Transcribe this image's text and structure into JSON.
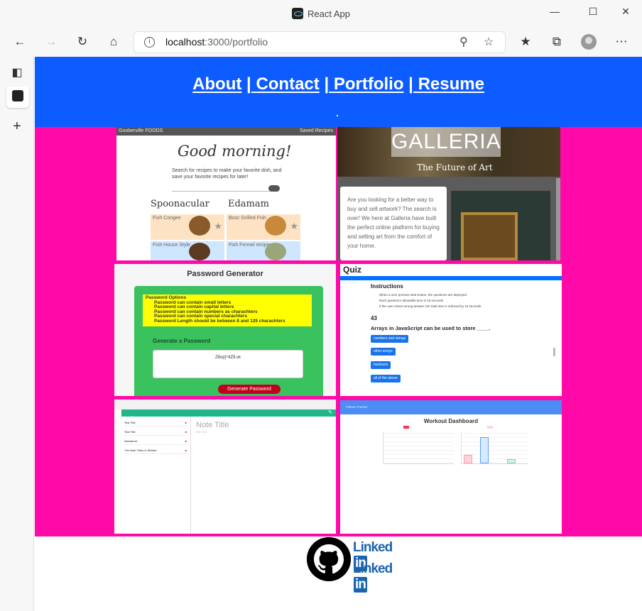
{
  "browser": {
    "window_title": "React App",
    "address_host": "localhost",
    "address_path": ":3000/portfolio"
  },
  "nav": {
    "about": "About",
    "contact": "Contact",
    "portfolio": "Portfolio",
    "resume": "Resume",
    "separator": "|"
  },
  "header_dot": ".",
  "projects": [
    {
      "name": "recipes",
      "bar_title": "Gooberville FOODS",
      "bar_right": "Saved Recipes",
      "heading": "Good morning!",
      "subheading": "Search for recipes to make your favorite dish, and save your favorite recipes for later!",
      "col1": "Spoonacular",
      "col2": "Edamam",
      "cards": [
        "Fish Congee",
        "Bosc Grilled Fish",
        "Fish House Style",
        "Fish Fennel recipes"
      ]
    },
    {
      "name": "galleria",
      "title": "GALLERIA",
      "tagline": "The Future of Art",
      "body": "Are you looking for a better way to buy and sell artwork? The search is over! We here at Galleria have built the perfect online platform for buying and selling art from the comfort of your home."
    },
    {
      "name": "password-generator",
      "title": "Password Generator",
      "options_title": "Password Options",
      "options": [
        "Password can contain small letters",
        "Password can contain capital letters",
        "Password can contain numbers as charachters",
        "Password can contain special charachters",
        "Password Length should be between 8 and 129 charachters"
      ],
      "generate_heading": "Generate a Password",
      "output": "Z8op}*4Z9.vk",
      "button": "Generate Password"
    },
    {
      "name": "quiz",
      "title": "Quiz",
      "bar_label": "View Scores",
      "instructions_title": "Instructions",
      "instructions": [
        "When a user presses start button, the questions are deployed",
        "Each question's allowable time is 15 seconds",
        "If the user enters wrong answer, the total time is reduced by 10 seconds"
      ],
      "timer": "43",
      "question": "Arrays in JavaScript can be used to store ____.",
      "answers": [
        "numbers and strings",
        "other arrays",
        "booleans",
        "all of the above"
      ]
    },
    {
      "name": "note-taker",
      "app_title": "Note Taker",
      "notes": [
        "Test Title",
        "Test Title",
        "Newsbeat",
        "The Note Taker Is Started"
      ],
      "note_title_placeholder": "Note Title",
      "note_text_placeholder": "Note Text"
    },
    {
      "name": "workout-dashboard",
      "bar_label": "Fitness Tracker",
      "title": "Workout Dashboard"
    }
  ],
  "footer": {
    "linkedin_word": "Linked",
    "linkedin_in": "in"
  },
  "colors": {
    "header": "#0d5cff",
    "grid_background": "#ff0aa8",
    "footer": "#ffffff"
  },
  "icons": [
    "back-icon",
    "forward-icon",
    "refresh-icon",
    "home-icon",
    "info-icon",
    "zoom-icon",
    "add-favorite-icon",
    "favorites-icon",
    "collections-icon",
    "profile-icon",
    "more-icon",
    "tabs-icon",
    "react-tab-icon",
    "add-tab-icon",
    "github-icon",
    "linkedin-icon"
  ]
}
